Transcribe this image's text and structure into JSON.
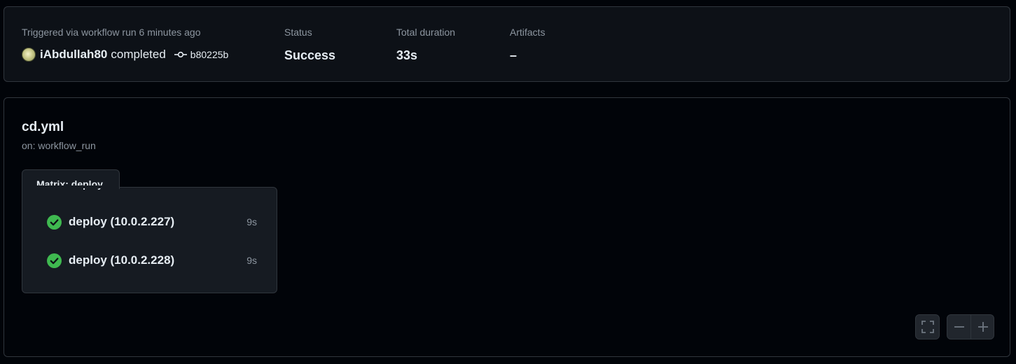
{
  "summary": {
    "trigger_text": "Triggered via workflow run 6 minutes ago",
    "actor": "iAbdullah80",
    "action": "completed",
    "commit_sha": "b80225b",
    "status_label": "Status",
    "status_value": "Success",
    "duration_label": "Total duration",
    "duration_value": "33s",
    "artifacts_label": "Artifacts",
    "artifacts_value": "–"
  },
  "workflow": {
    "name": "cd.yml",
    "trigger": "on: workflow_run",
    "matrix_label": "Matrix: deploy",
    "jobs": [
      {
        "name": "deploy (10.0.2.227)",
        "duration": "9s",
        "status": "success",
        "icon": "check-circle-icon"
      },
      {
        "name": "deploy (10.0.2.228)",
        "duration": "9s",
        "status": "success",
        "icon": "check-circle-icon"
      }
    ]
  },
  "controls": {
    "fullscreen_icon": "fullscreen-icon",
    "zoom_out_icon": "minus-icon",
    "zoom_in_icon": "plus-icon"
  },
  "colors": {
    "success": "#3fb950",
    "background": "#010409",
    "panel": "#0d1117",
    "border": "#30363d"
  }
}
